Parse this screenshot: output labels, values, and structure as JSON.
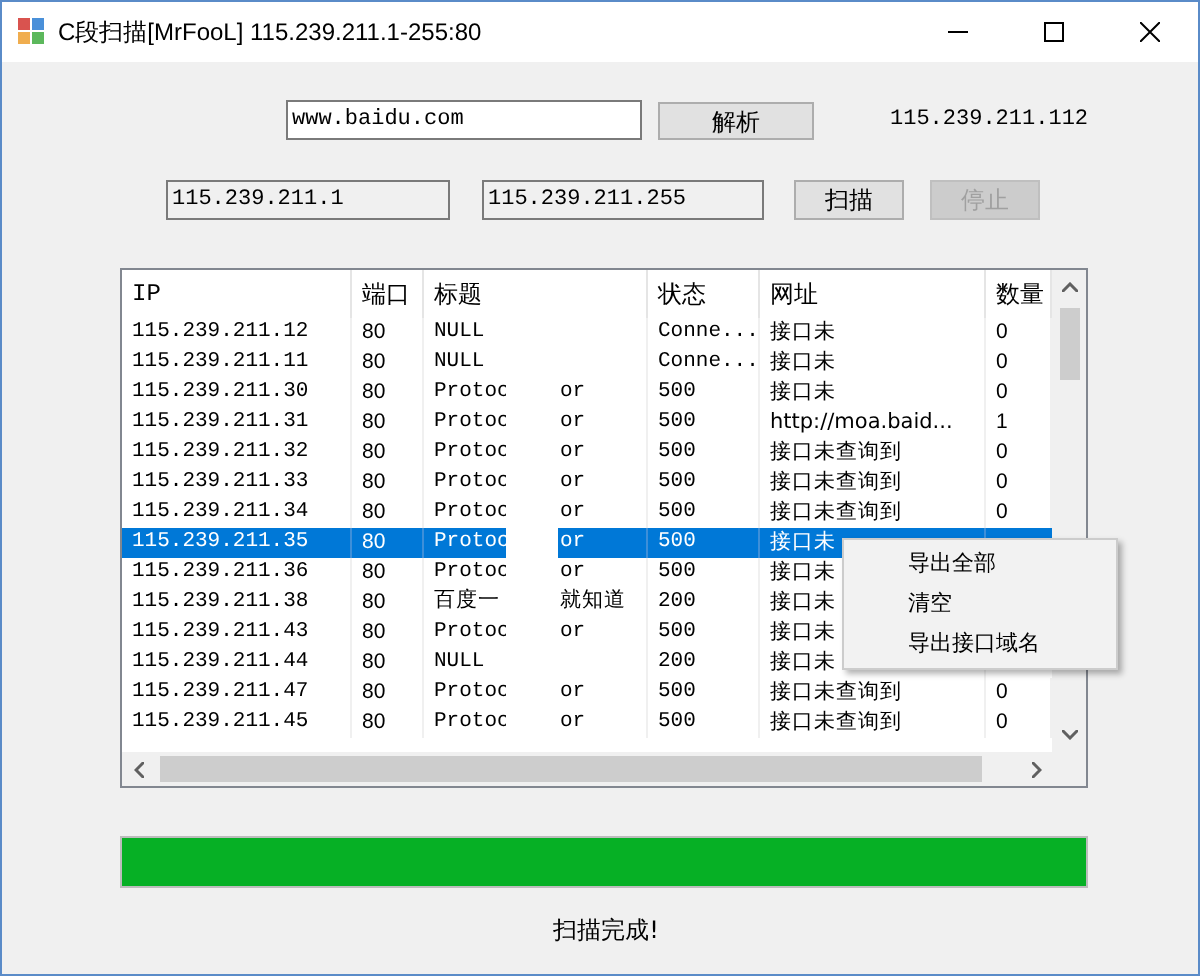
{
  "window": {
    "title": "C段扫描[MrFooL] 115.239.211.1-255:80"
  },
  "domain": {
    "value": "www.baidu.com",
    "button": "解析",
    "result": "115.239.211.112"
  },
  "range": {
    "start": "115.239.211.1",
    "end": "115.239.211.255",
    "scan_button": "扫描",
    "stop_button": {
      "label": "停止",
      "disabled": true
    }
  },
  "table": {
    "columns": [
      "IP",
      "端口",
      "标题",
      "状态",
      "网址",
      "数量"
    ],
    "rows": [
      {
        "ip": "115.239.211.12",
        "port": "80",
        "title_left": "NULL",
        "status": "Conne...",
        "url": "接口未",
        "count": "0",
        "selected": false
      },
      {
        "ip": "115.239.211.11",
        "port": "80",
        "title_left": "NULL",
        "status": "Conne...",
        "url": "接口未",
        "count": "0",
        "selected": false
      },
      {
        "ip": "115.239.211.30",
        "port": "80",
        "title_left": "Protoc",
        "title_right": "or",
        "status": "500",
        "url": "接口未",
        "count": "0",
        "selected": false
      },
      {
        "ip": "115.239.211.31",
        "port": "80",
        "title_left": "Protoc",
        "title_right": "or",
        "status": "500",
        "url": "http://moa.baid...",
        "count": "1",
        "selected": false
      },
      {
        "ip": "115.239.211.32",
        "port": "80",
        "title_left": "Protoc",
        "title_right": "or",
        "status": "500",
        "url": "接口未查询到",
        "count": "0",
        "selected": false
      },
      {
        "ip": "115.239.211.33",
        "port": "80",
        "title_left": "Protoc",
        "title_right": "or",
        "status": "500",
        "url": "接口未查询到",
        "count": "0",
        "selected": false
      },
      {
        "ip": "115.239.211.34",
        "port": "80",
        "title_left": "Protoc",
        "title_right": "or",
        "status": "500",
        "url": "接口未查询到",
        "count": "0",
        "selected": false
      },
      {
        "ip": "115.239.211.35",
        "port": "80",
        "title_left": "Protoc",
        "title_right": "or",
        "status": "500",
        "url": "接口未",
        "selected": true
      },
      {
        "ip": "115.239.211.36",
        "port": "80",
        "title_left": "Protoc",
        "title_right": "or",
        "status": "500",
        "url": "接口未",
        "selected": false
      },
      {
        "ip": "115.239.211.38",
        "port": "80",
        "title_left": "百度一",
        "title_right": "就知道",
        "status": "200",
        "url": "接口未",
        "selected": false
      },
      {
        "ip": "115.239.211.43",
        "port": "80",
        "title_left": "Protoc",
        "title_right": "or",
        "status": "500",
        "url": "接口未",
        "selected": false
      },
      {
        "ip": "115.239.211.44",
        "port": "80",
        "title_left": "NULL",
        "status": "200",
        "url": "接口未",
        "selected": false
      },
      {
        "ip": "115.239.211.47",
        "port": "80",
        "title_left": "Protoc",
        "title_right": "or",
        "status": "500",
        "url": "接口未查询到",
        "count": "0",
        "selected": false
      },
      {
        "ip": "115.239.211.45",
        "port": "80",
        "title_left": "Protoc",
        "title_right": "or",
        "status": "500",
        "url": "接口未查询到",
        "count": "0",
        "selected": false
      }
    ]
  },
  "context_menu": [
    "导出全部",
    "清空",
    "导出接口域名"
  ],
  "progress": {
    "level": 1
  },
  "status": "扫描完成!"
}
